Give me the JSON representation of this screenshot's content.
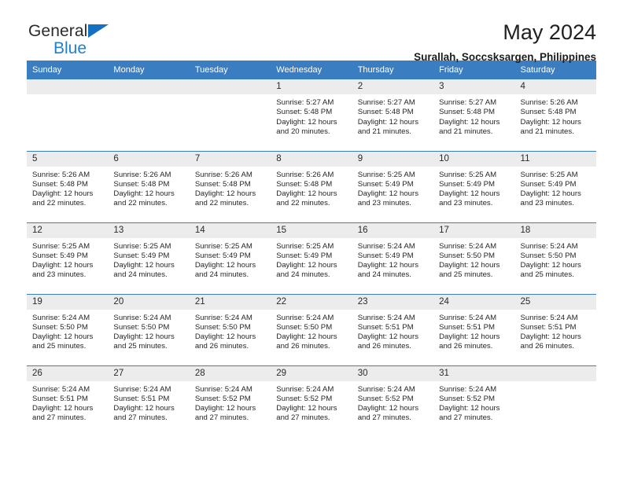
{
  "brand": {
    "name_part1": "General",
    "name_part2": "Blue",
    "logo_icon": "triangle-logo-icon"
  },
  "header": {
    "title": "May 2024",
    "location": "Surallah, Soccsksargen, Philippines"
  },
  "colors": {
    "header_blue": "#3A7DC0",
    "brand_blue": "#1F7FD4",
    "daynum_band": "#ECECEC",
    "text": "#262626"
  },
  "weekday_headers": [
    "Sunday",
    "Monday",
    "Tuesday",
    "Wednesday",
    "Thursday",
    "Friday",
    "Saturday"
  ],
  "labels": {
    "sunrise_prefix": "Sunrise: ",
    "sunset_prefix": "Sunset: ",
    "daylight_prefix": "Daylight: "
  },
  "weeks": [
    [
      {
        "day": "",
        "sunrise": "",
        "sunset": "",
        "daylight_line1": "",
        "daylight_line2": ""
      },
      {
        "day": "",
        "sunrise": "",
        "sunset": "",
        "daylight_line1": "",
        "daylight_line2": ""
      },
      {
        "day": "",
        "sunrise": "",
        "sunset": "",
        "daylight_line1": "",
        "daylight_line2": ""
      },
      {
        "day": "1",
        "sunrise": "Sunrise: 5:27 AM",
        "sunset": "Sunset: 5:48 PM",
        "daylight_line1": "Daylight: 12 hours",
        "daylight_line2": "and 20 minutes."
      },
      {
        "day": "2",
        "sunrise": "Sunrise: 5:27 AM",
        "sunset": "Sunset: 5:48 PM",
        "daylight_line1": "Daylight: 12 hours",
        "daylight_line2": "and 21 minutes."
      },
      {
        "day": "3",
        "sunrise": "Sunrise: 5:27 AM",
        "sunset": "Sunset: 5:48 PM",
        "daylight_line1": "Daylight: 12 hours",
        "daylight_line2": "and 21 minutes."
      },
      {
        "day": "4",
        "sunrise": "Sunrise: 5:26 AM",
        "sunset": "Sunset: 5:48 PM",
        "daylight_line1": "Daylight: 12 hours",
        "daylight_line2": "and 21 minutes."
      }
    ],
    [
      {
        "day": "5",
        "sunrise": "Sunrise: 5:26 AM",
        "sunset": "Sunset: 5:48 PM",
        "daylight_line1": "Daylight: 12 hours",
        "daylight_line2": "and 22 minutes."
      },
      {
        "day": "6",
        "sunrise": "Sunrise: 5:26 AM",
        "sunset": "Sunset: 5:48 PM",
        "daylight_line1": "Daylight: 12 hours",
        "daylight_line2": "and 22 minutes."
      },
      {
        "day": "7",
        "sunrise": "Sunrise: 5:26 AM",
        "sunset": "Sunset: 5:48 PM",
        "daylight_line1": "Daylight: 12 hours",
        "daylight_line2": "and 22 minutes."
      },
      {
        "day": "8",
        "sunrise": "Sunrise: 5:26 AM",
        "sunset": "Sunset: 5:48 PM",
        "daylight_line1": "Daylight: 12 hours",
        "daylight_line2": "and 22 minutes."
      },
      {
        "day": "9",
        "sunrise": "Sunrise: 5:25 AM",
        "sunset": "Sunset: 5:49 PM",
        "daylight_line1": "Daylight: 12 hours",
        "daylight_line2": "and 23 minutes."
      },
      {
        "day": "10",
        "sunrise": "Sunrise: 5:25 AM",
        "sunset": "Sunset: 5:49 PM",
        "daylight_line1": "Daylight: 12 hours",
        "daylight_line2": "and 23 minutes."
      },
      {
        "day": "11",
        "sunrise": "Sunrise: 5:25 AM",
        "sunset": "Sunset: 5:49 PM",
        "daylight_line1": "Daylight: 12 hours",
        "daylight_line2": "and 23 minutes."
      }
    ],
    [
      {
        "day": "12",
        "sunrise": "Sunrise: 5:25 AM",
        "sunset": "Sunset: 5:49 PM",
        "daylight_line1": "Daylight: 12 hours",
        "daylight_line2": "and 23 minutes."
      },
      {
        "day": "13",
        "sunrise": "Sunrise: 5:25 AM",
        "sunset": "Sunset: 5:49 PM",
        "daylight_line1": "Daylight: 12 hours",
        "daylight_line2": "and 24 minutes."
      },
      {
        "day": "14",
        "sunrise": "Sunrise: 5:25 AM",
        "sunset": "Sunset: 5:49 PM",
        "daylight_line1": "Daylight: 12 hours",
        "daylight_line2": "and 24 minutes."
      },
      {
        "day": "15",
        "sunrise": "Sunrise: 5:25 AM",
        "sunset": "Sunset: 5:49 PM",
        "daylight_line1": "Daylight: 12 hours",
        "daylight_line2": "and 24 minutes."
      },
      {
        "day": "16",
        "sunrise": "Sunrise: 5:24 AM",
        "sunset": "Sunset: 5:49 PM",
        "daylight_line1": "Daylight: 12 hours",
        "daylight_line2": "and 24 minutes."
      },
      {
        "day": "17",
        "sunrise": "Sunrise: 5:24 AM",
        "sunset": "Sunset: 5:50 PM",
        "daylight_line1": "Daylight: 12 hours",
        "daylight_line2": "and 25 minutes."
      },
      {
        "day": "18",
        "sunrise": "Sunrise: 5:24 AM",
        "sunset": "Sunset: 5:50 PM",
        "daylight_line1": "Daylight: 12 hours",
        "daylight_line2": "and 25 minutes."
      }
    ],
    [
      {
        "day": "19",
        "sunrise": "Sunrise: 5:24 AM",
        "sunset": "Sunset: 5:50 PM",
        "daylight_line1": "Daylight: 12 hours",
        "daylight_line2": "and 25 minutes."
      },
      {
        "day": "20",
        "sunrise": "Sunrise: 5:24 AM",
        "sunset": "Sunset: 5:50 PM",
        "daylight_line1": "Daylight: 12 hours",
        "daylight_line2": "and 25 minutes."
      },
      {
        "day": "21",
        "sunrise": "Sunrise: 5:24 AM",
        "sunset": "Sunset: 5:50 PM",
        "daylight_line1": "Daylight: 12 hours",
        "daylight_line2": "and 26 minutes."
      },
      {
        "day": "22",
        "sunrise": "Sunrise: 5:24 AM",
        "sunset": "Sunset: 5:50 PM",
        "daylight_line1": "Daylight: 12 hours",
        "daylight_line2": "and 26 minutes."
      },
      {
        "day": "23",
        "sunrise": "Sunrise: 5:24 AM",
        "sunset": "Sunset: 5:51 PM",
        "daylight_line1": "Daylight: 12 hours",
        "daylight_line2": "and 26 minutes."
      },
      {
        "day": "24",
        "sunrise": "Sunrise: 5:24 AM",
        "sunset": "Sunset: 5:51 PM",
        "daylight_line1": "Daylight: 12 hours",
        "daylight_line2": "and 26 minutes."
      },
      {
        "day": "25",
        "sunrise": "Sunrise: 5:24 AM",
        "sunset": "Sunset: 5:51 PM",
        "daylight_line1": "Daylight: 12 hours",
        "daylight_line2": "and 26 minutes."
      }
    ],
    [
      {
        "day": "26",
        "sunrise": "Sunrise: 5:24 AM",
        "sunset": "Sunset: 5:51 PM",
        "daylight_line1": "Daylight: 12 hours",
        "daylight_line2": "and 27 minutes."
      },
      {
        "day": "27",
        "sunrise": "Sunrise: 5:24 AM",
        "sunset": "Sunset: 5:51 PM",
        "daylight_line1": "Daylight: 12 hours",
        "daylight_line2": "and 27 minutes."
      },
      {
        "day": "28",
        "sunrise": "Sunrise: 5:24 AM",
        "sunset": "Sunset: 5:52 PM",
        "daylight_line1": "Daylight: 12 hours",
        "daylight_line2": "and 27 minutes."
      },
      {
        "day": "29",
        "sunrise": "Sunrise: 5:24 AM",
        "sunset": "Sunset: 5:52 PM",
        "daylight_line1": "Daylight: 12 hours",
        "daylight_line2": "and 27 minutes."
      },
      {
        "day": "30",
        "sunrise": "Sunrise: 5:24 AM",
        "sunset": "Sunset: 5:52 PM",
        "daylight_line1": "Daylight: 12 hours",
        "daylight_line2": "and 27 minutes."
      },
      {
        "day": "31",
        "sunrise": "Sunrise: 5:24 AM",
        "sunset": "Sunset: 5:52 PM",
        "daylight_line1": "Daylight: 12 hours",
        "daylight_line2": "and 27 minutes."
      },
      {
        "day": "",
        "sunrise": "",
        "sunset": "",
        "daylight_line1": "",
        "daylight_line2": ""
      }
    ]
  ]
}
